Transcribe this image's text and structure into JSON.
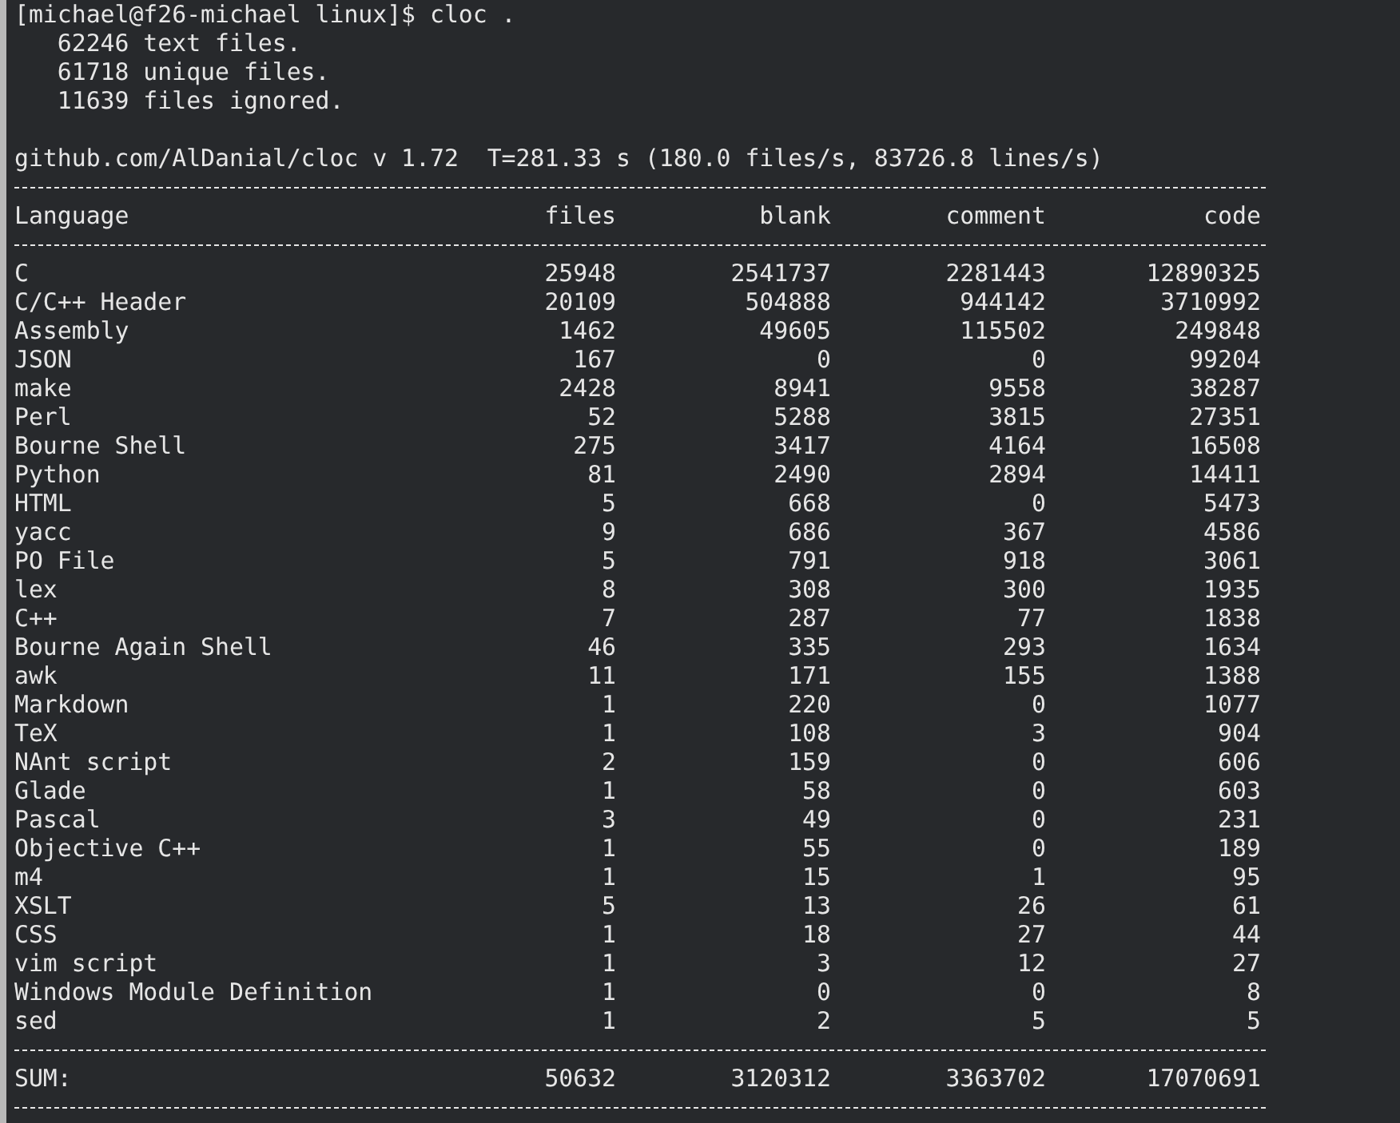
{
  "prompt": "[michael@f26-michael linux]$ cloc .",
  "progress": [
    "   62246 text files.",
    "   61718 unique files.",
    "   11639 files ignored."
  ],
  "summary": "github.com/AlDanial/cloc v 1.72  T=281.33 s (180.0 files/s, 83726.8 lines/s)",
  "table": {
    "columns": [
      "Language",
      "files",
      "blank",
      "comment",
      "code"
    ],
    "rows": [
      [
        "C",
        "25948",
        "2541737",
        "2281443",
        "12890325"
      ],
      [
        "C/C++ Header",
        "20109",
        "504888",
        "944142",
        "3710992"
      ],
      [
        "Assembly",
        "1462",
        "49605",
        "115502",
        "249848"
      ],
      [
        "JSON",
        "167",
        "0",
        "0",
        "99204"
      ],
      [
        "make",
        "2428",
        "8941",
        "9558",
        "38287"
      ],
      [
        "Perl",
        "52",
        "5288",
        "3815",
        "27351"
      ],
      [
        "Bourne Shell",
        "275",
        "3417",
        "4164",
        "16508"
      ],
      [
        "Python",
        "81",
        "2490",
        "2894",
        "14411"
      ],
      [
        "HTML",
        "5",
        "668",
        "0",
        "5473"
      ],
      [
        "yacc",
        "9",
        "686",
        "367",
        "4586"
      ],
      [
        "PO File",
        "5",
        "791",
        "918",
        "3061"
      ],
      [
        "lex",
        "8",
        "308",
        "300",
        "1935"
      ],
      [
        "C++",
        "7",
        "287",
        "77",
        "1838"
      ],
      [
        "Bourne Again Shell",
        "46",
        "335",
        "293",
        "1634"
      ],
      [
        "awk",
        "11",
        "171",
        "155",
        "1388"
      ],
      [
        "Markdown",
        "1",
        "220",
        "0",
        "1077"
      ],
      [
        "TeX",
        "1",
        "108",
        "3",
        "904"
      ],
      [
        "NAnt script",
        "2",
        "159",
        "0",
        "606"
      ],
      [
        "Glade",
        "1",
        "58",
        "0",
        "603"
      ],
      [
        "Pascal",
        "3",
        "49",
        "0",
        "231"
      ],
      [
        "Objective C++",
        "1",
        "55",
        "0",
        "189"
      ],
      [
        "m4",
        "1",
        "15",
        "1",
        "95"
      ],
      [
        "XSLT",
        "5",
        "13",
        "26",
        "61"
      ],
      [
        "CSS",
        "1",
        "18",
        "27",
        "44"
      ],
      [
        "vim script",
        "1",
        "3",
        "12",
        "27"
      ],
      [
        "Windows Module Definition",
        "1",
        "0",
        "0",
        "8"
      ],
      [
        "sed",
        "1",
        "2",
        "5",
        "5"
      ]
    ],
    "sum": [
      "SUM:",
      "50632",
      "3120312",
      "3363702",
      "17070691"
    ]
  }
}
